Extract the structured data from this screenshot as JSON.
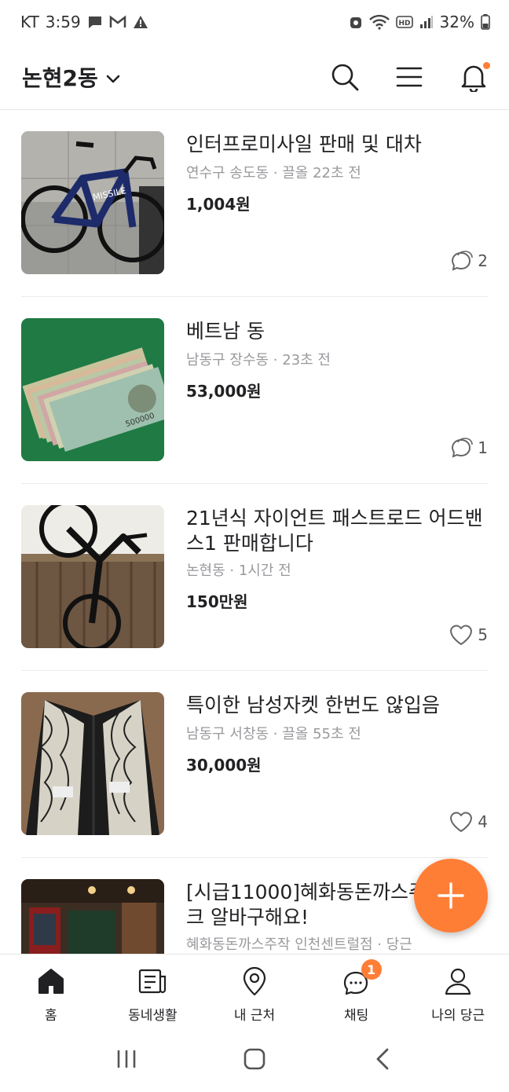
{
  "status_bar": {
    "carrier": "KT",
    "time": "3:59",
    "battery": "32%"
  },
  "header": {
    "location": "논현2동"
  },
  "items": [
    {
      "title": "인터프로미사일 판매 및 대차",
      "meta": "연수구 송도동 · 끌올 22초 전",
      "price": "1,004원",
      "count_type": "chat",
      "count": "2"
    },
    {
      "title": "베트남 동",
      "meta": "남동구 장수동 · 23초 전",
      "price": "53,000원",
      "count_type": "chat",
      "count": "1"
    },
    {
      "title": "21년식 자이언트 패스트로드 어드밴스1 판매합니다",
      "meta": "논현동 · 1시간 전",
      "price": "150만원",
      "count_type": "heart",
      "count": "5"
    },
    {
      "title": "특이한 남성자켓  한번도 않입음",
      "meta": "남동구 서창동 · 끌올 55초 전",
      "price": "30,000원",
      "count_type": "heart",
      "count": "4"
    },
    {
      "title": "[시급11000]혜화동돈까스주 커낼워크 알바구해요!",
      "meta": "혜화동돈까스주작 인천센트럴점 · 당근",
      "price": "",
      "count_type": "",
      "count": ""
    }
  ],
  "bottom_nav": [
    {
      "label": "홈",
      "icon": "home-icon"
    },
    {
      "label": "동네생활",
      "icon": "newspaper-icon"
    },
    {
      "label": "내 근처",
      "icon": "location-pin-icon"
    },
    {
      "label": "채팅",
      "icon": "chat-icon",
      "badge": "1"
    },
    {
      "label": "나의 당근",
      "icon": "person-icon"
    }
  ],
  "colors": {
    "accent": "#ff7e36",
    "text": "#212124",
    "meta": "#9a9a9e"
  }
}
